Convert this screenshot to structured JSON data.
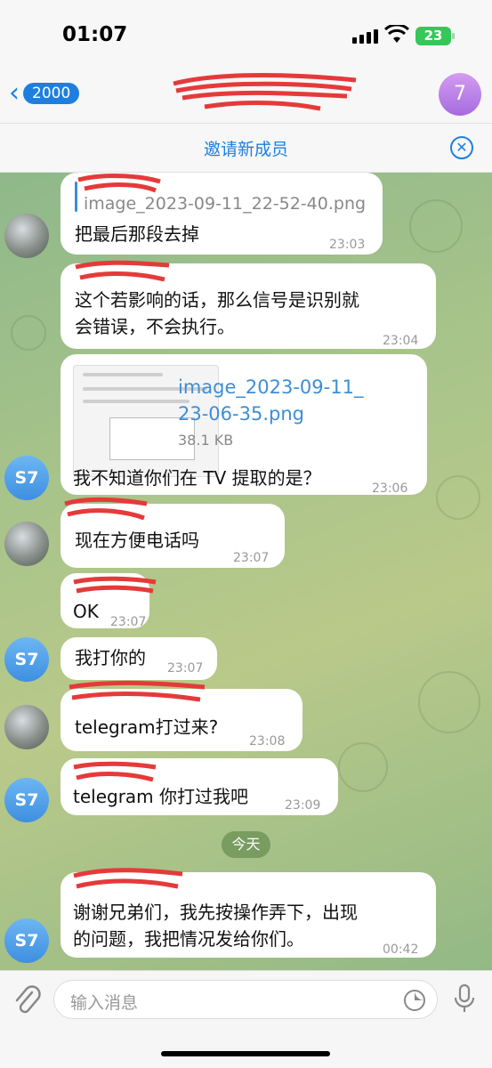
{
  "status": {
    "time": "01:07",
    "battery": "23"
  },
  "nav": {
    "back_count": "2000",
    "avatar_letter": "7"
  },
  "invite": {
    "label": "邀请新成员",
    "close_icon": "close-circle-icon"
  },
  "messages": [
    {
      "reply_file": "image_2023-09-11_22-52-40.png",
      "text": "把最后那段去掉",
      "time": "23:03"
    },
    {
      "text_line1": "这个若影响的话，那么信号是识别就",
      "text_line2": "会错误，不会执行。",
      "time": "23:04"
    },
    {
      "file_name_line1": "image_2023-09-11_",
      "file_name_line2": "23-06-35.png",
      "file_size": "38.1 KB",
      "text": "我不知道你们在 TV 提取的是？",
      "time": "23:06",
      "avatar": "S7"
    },
    {
      "text": "现在方便电话吗",
      "time": "23:07"
    },
    {
      "text": "OK",
      "time": "23:07"
    },
    {
      "text": "我打你的",
      "time": "23:07",
      "avatar": "S7"
    },
    {
      "text": "telegram打过来?",
      "time": "23:08"
    },
    {
      "text": "telegram  你打过我吧",
      "time": "23:09",
      "avatar": "S7"
    },
    {
      "text_line1": "谢谢兄弟们，我先按操作弄下，出现",
      "text_line2": "的问题，我把情况发给你们。",
      "time": "00:42",
      "avatar": "S7"
    }
  ],
  "date_divider": "今天",
  "input": {
    "placeholder": "输入消息"
  },
  "colors": {
    "accent": "#1f7fe0",
    "sender": "#3d8ed6",
    "s7_avatar": "#4a9ae8"
  }
}
